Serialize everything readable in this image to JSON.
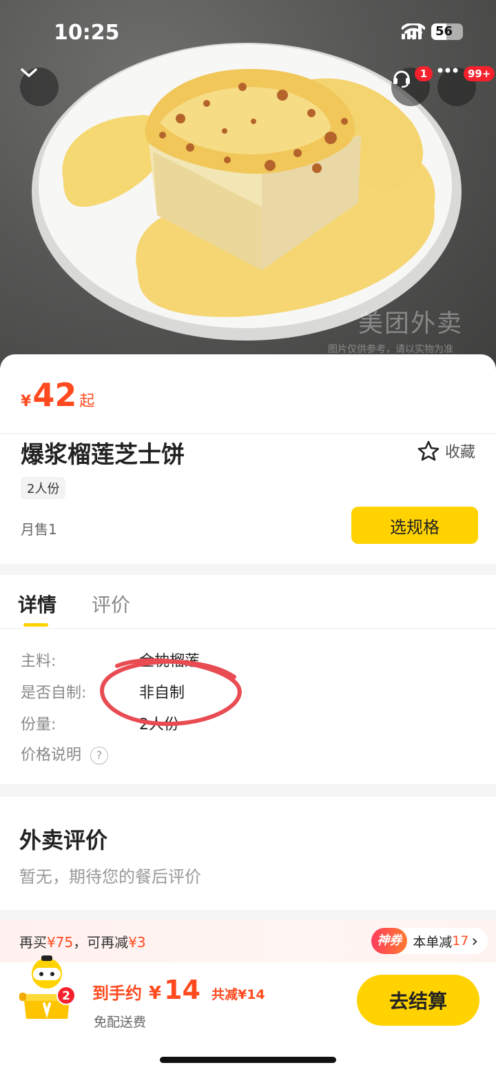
{
  "status_bar": {
    "time": "10:25",
    "battery": "56",
    "icons": [
      "signal-icon",
      "wifi-icon",
      "battery-icon"
    ]
  },
  "header": {
    "collapse_icon": "chevron-down-icon",
    "service_icon": "customer-service-icon",
    "service_badge": "1",
    "more_icon": "more-dots-icon",
    "more_badge": "99+"
  },
  "hero": {
    "watermark": "美团外卖",
    "disclaimer": "图片仅供参考，请以实物为准"
  },
  "product": {
    "currency": "¥",
    "price": "42",
    "price_suffix": "起",
    "title": "爆浆榴莲芝士饼",
    "favorite_label": "收藏",
    "portion_tag": "2人份",
    "monthly_sales": "月售1",
    "select_spec_label": "选规格"
  },
  "tabs": [
    {
      "label": "详情",
      "active": true
    },
    {
      "label": "评价",
      "active": false
    }
  ],
  "details": {
    "rows": [
      {
        "label": "主料:",
        "value": "金枕榴莲"
      },
      {
        "label": "是否自制:",
        "value": "非自制"
      },
      {
        "label": "份量:",
        "value": "2人份"
      }
    ],
    "price_note_label": "价格说明",
    "price_note_icon": "?"
  },
  "reviews": {
    "title": "外卖评价",
    "empty_text": "暂无，期待您的餐后评价"
  },
  "promo": {
    "text_prefix": "再买",
    "amount_more": "¥75",
    "text_middle": "，可再减",
    "amount_off": "¥3",
    "shenquan_label": "神券",
    "order_discount_label": "本单减",
    "order_discount_value": "17",
    "arrow": "›"
  },
  "cart": {
    "count_badge": "2",
    "total_label": "到手约",
    "currency": "¥",
    "total": "14",
    "saved": "共减¥14",
    "delivery": "免配送费",
    "checkout_label": "去结算"
  },
  "colors": {
    "accent_yellow": "#ffd200",
    "price_red": "#ff4a1f",
    "badge_red": "#f5222d"
  }
}
